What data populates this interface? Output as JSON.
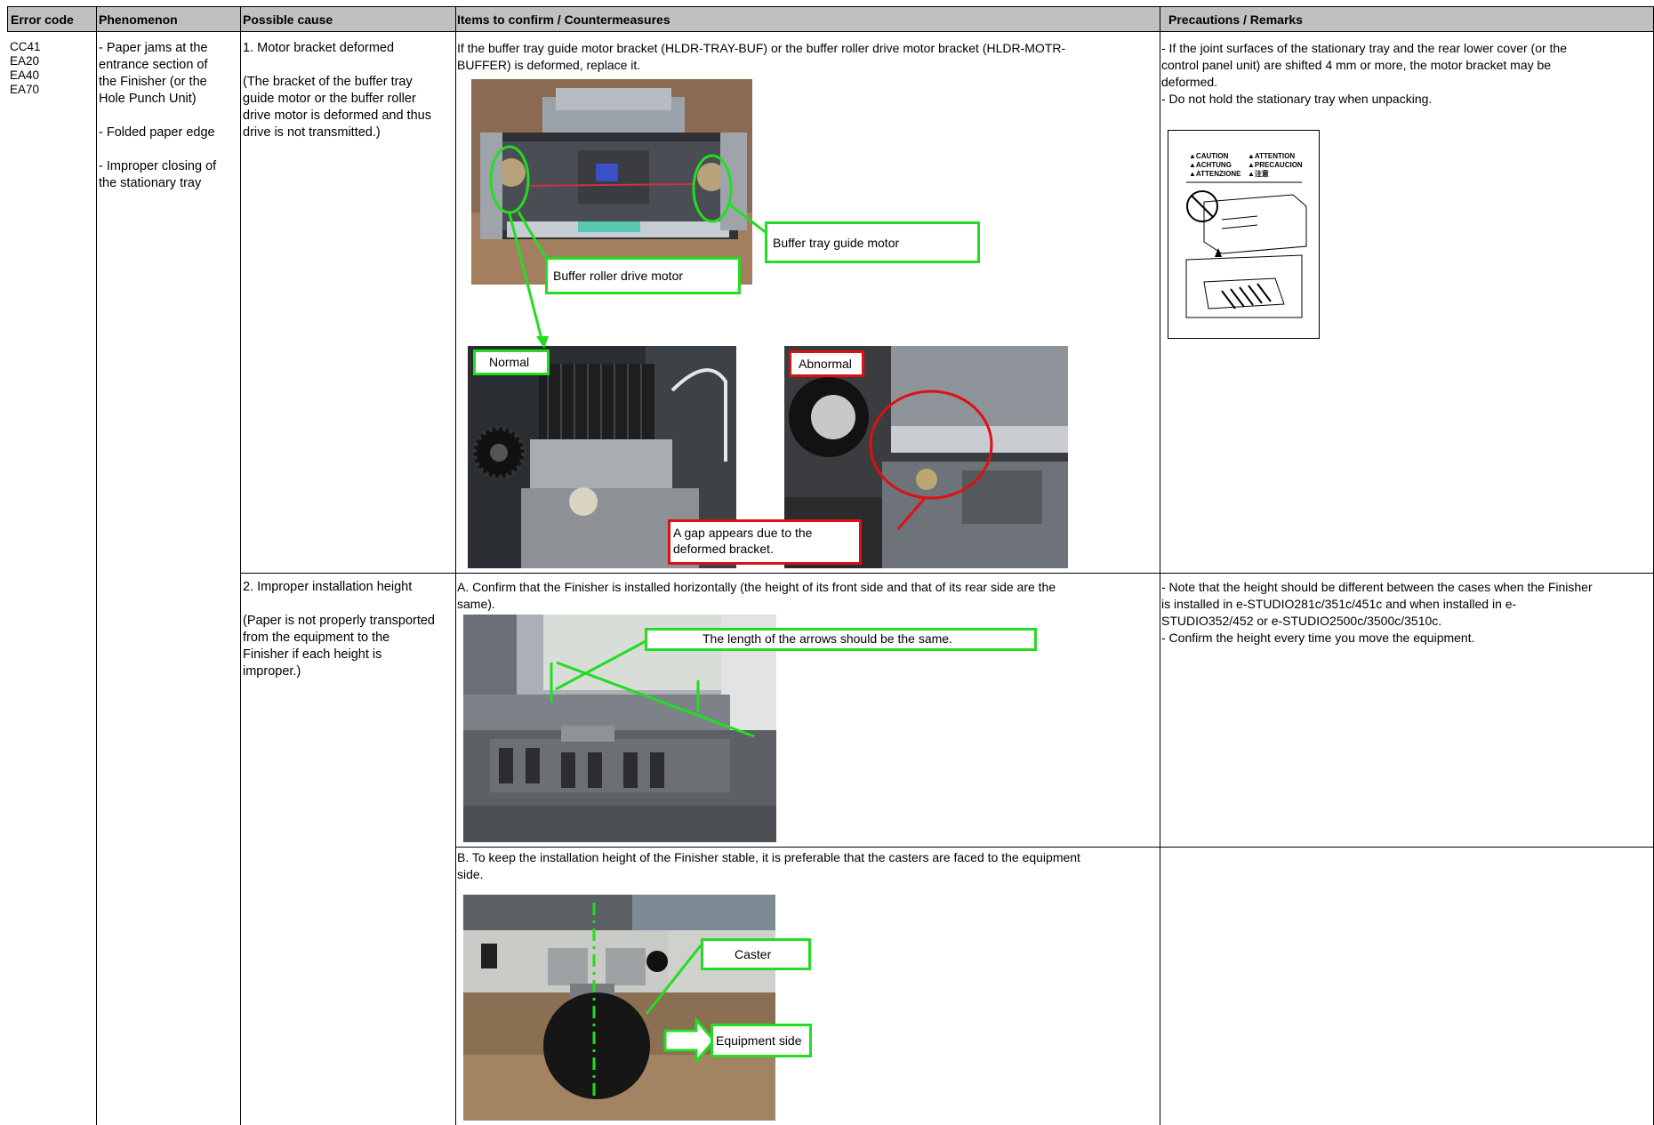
{
  "headers": {
    "error_code": "Error code",
    "phenomenon": "Phenomenon",
    "possible_cause": "Possible cause",
    "items": "Items to confirm / Countermeasures",
    "precautions": "Precautions / Remarks"
  },
  "error_codes": "CC41\nEA20\nEA40\nEA70",
  "phenomenon": "- Paper jams at the\nentrance section of\nthe Finisher (or the\nHole Punch Unit)\n\n- Folded paper edge\n\n- Improper closing of\nthe stationary tray",
  "cause1": "1. Motor bracket deformed\n\n(The bracket of the buffer tray\nguide motor or the buffer roller\ndrive motor is deformed and thus\ndrive is not transmitted.)",
  "item1": "If the buffer tray guide motor bracket (HLDR-TRAY-BUF) or the buffer roller drive motor bracket (HLDR-MOTR-\nBUFFER) is deformed, replace it.",
  "label_buffer_tray_guide_motor": "Buffer tray guide motor",
  "label_buffer_roller_drive_motor": "Buffer roller drive motor",
  "label_normal": "Normal",
  "label_abnormal": "Abnormal",
  "label_gap": "A gap appears due to the\ndeformed bracket.",
  "remark1": "- If the joint surfaces of the stationary tray and the rear lower cover (or the\ncontrol panel unit) are shifted 4 mm or more, the motor bracket may be\ndeformed.\n- Do not hold the stationary tray when unpacking.",
  "caution_words": {
    "w1": "▲CAUTION",
    "w2": "▲ATTENTION",
    "w3": "▲ACHTUNG",
    "w4": "▲PRECAUCION",
    "w5": "▲ATTENZIONE",
    "w6": "▲注意"
  },
  "cause2": "2. Improper installation height\n\n(Paper is not properly transported\nfrom the equipment to the\nFinisher if each height is\nimproper.)",
  "item2a": "A. Confirm that the Finisher is installed horizontally (the height of its front side and that of its rear side are the\nsame).",
  "label_arrows": "The length of the arrows should be the same.",
  "remark2": "- Note that the height should be different between the cases when the Finisher\nis installed in e-STUDIO281c/351c/451c and when installed in e-\nSTUDIO352/452 or e-STUDIO2500c/3500c/3510c.\n- Confirm the height every time you move the equipment.",
  "item2b": "B. To keep the installation height of the Finisher stable, it is preferable that the casters are faced to the equipment\nside.",
  "label_caster": "Caster",
  "label_equipment_side": "Equipment side",
  "colors": {
    "header_bg": "#c0c0c0",
    "callout_green": "#22dd22",
    "callout_red": "#dd1111"
  }
}
